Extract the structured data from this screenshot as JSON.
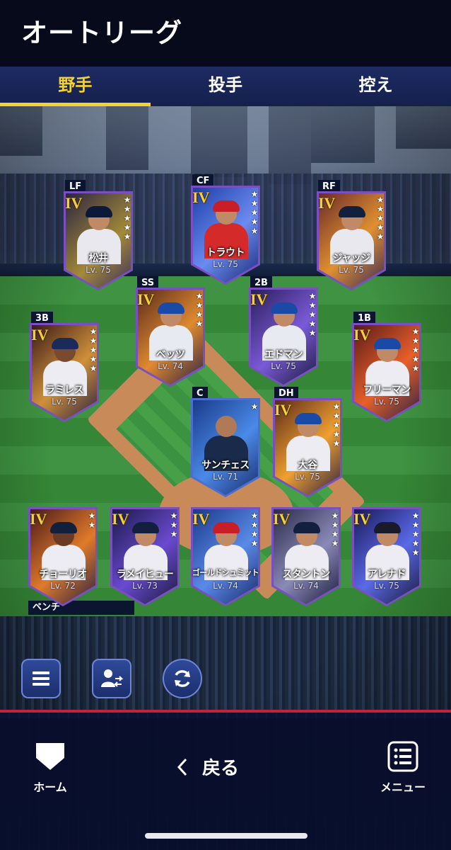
{
  "header": {
    "title": "オートリーグ"
  },
  "tabs": [
    {
      "label": "野手",
      "active": true
    },
    {
      "label": "投手",
      "active": false
    },
    {
      "label": "控え",
      "active": false
    }
  ],
  "lineup": {
    "lf": {
      "pos": "LF",
      "tier": "IV",
      "name": "松井",
      "level": "Lv. 75",
      "stars": 5
    },
    "cf": {
      "pos": "CF",
      "tier": "IV",
      "name": "トラウト",
      "level": "Lv. 75",
      "stars": 5
    },
    "rf": {
      "pos": "RF",
      "tier": "IV",
      "name": "ジャッジ",
      "level": "Lv. 75",
      "stars": 5
    },
    "ss": {
      "pos": "SS",
      "tier": "IV",
      "name": "ベッツ",
      "level": "Lv. 74",
      "stars": 4
    },
    "second": {
      "pos": "2B",
      "tier": "IV",
      "name": "エドマン",
      "level": "Lv. 75",
      "stars": 5
    },
    "third": {
      "pos": "3B",
      "tier": "IV",
      "name": "ラミレス",
      "level": "Lv. 75",
      "stars": 5
    },
    "first": {
      "pos": "1B",
      "tier": "IV",
      "name": "フリーマン",
      "level": "Lv. 75",
      "stars": 5
    },
    "catcher": {
      "pos": "C",
      "tier": "",
      "name": "サンチェス",
      "level": "Lv. 71",
      "stars": 1
    },
    "dh": {
      "pos": "DH",
      "tier": "IV",
      "name": "大谷",
      "level": "Lv. 75",
      "stars": 5
    }
  },
  "bench": {
    "label": "ベンチ",
    "players": [
      {
        "tier": "IV",
        "name": "チョーリオ",
        "level": "Lv. 72",
        "stars": 2
      },
      {
        "tier": "IV",
        "name": "ラメイヒュー",
        "level": "Lv. 73",
        "stars": 3
      },
      {
        "tier": "IV",
        "name": "ゴールドシュミット",
        "level": "Lv. 74",
        "stars": 4
      },
      {
        "tier": "IV",
        "name": "スタントン",
        "level": "Lv. 74",
        "stars": 4
      },
      {
        "tier": "IV",
        "name": "アレナド",
        "level": "Lv. 75",
        "stars": 5
      }
    ]
  },
  "actions": {
    "list_icon": "list-icon",
    "swap_icon": "player-swap-icon",
    "refresh_icon": "refresh-icon"
  },
  "nav": {
    "home_label": "ホーム",
    "back_label": "戻る",
    "menu_label": "メニュー"
  },
  "colors": {
    "accent": "#f4d232",
    "tier": "#f6cf3a",
    "card_purple": "#7a4fc2",
    "nav_red": "#c0243a"
  }
}
